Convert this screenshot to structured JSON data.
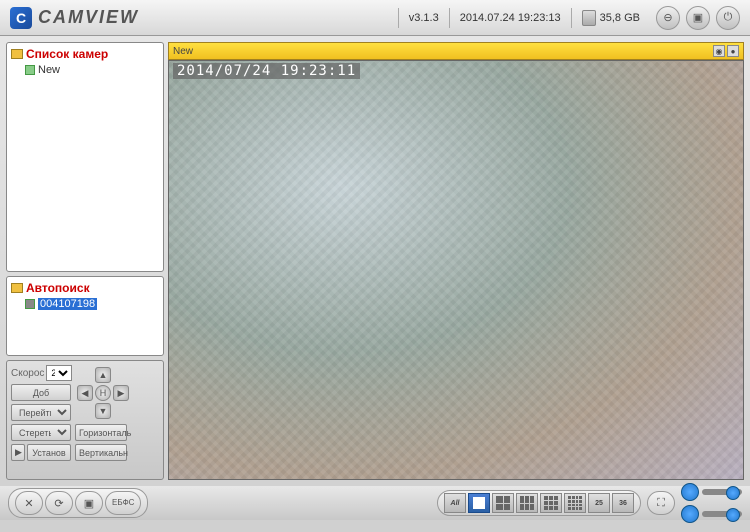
{
  "app": {
    "name": "CAMVIEW",
    "version": "v3.1.3",
    "datetime": "2014.07.24 19:23:13",
    "disk": "35,8 GB"
  },
  "sidebar": {
    "cameras": {
      "title": "Список камер",
      "items": [
        {
          "name": "New"
        }
      ]
    },
    "autosearch": {
      "title": "Автопоиск",
      "items": [
        {
          "id": "004107198"
        }
      ]
    }
  },
  "controls": {
    "speed_label": "Скорос",
    "speed_value": "2",
    "add": "Доб",
    "goto_preset": "Перейти к пред",
    "erase_preset": "Стереть предус",
    "install": "Установ",
    "horizontal": "Горизонталь",
    "vertical": "Вертикальн"
  },
  "viewer": {
    "tab": "New",
    "overlay": "2014/07/24 19:23:11"
  },
  "bottom": {
    "all": "All",
    "eb": "ЕБ",
    "fs": "ФС",
    "l25": "25",
    "l36": "36"
  }
}
